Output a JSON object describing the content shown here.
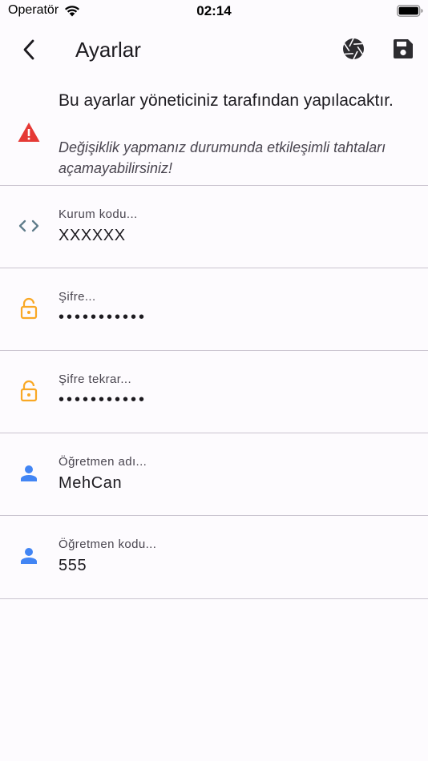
{
  "status_bar": {
    "carrier": "Operatör",
    "time": "02:14"
  },
  "app_bar": {
    "title": "Ayarlar"
  },
  "warning": {
    "title": "Bu ayarlar yöneticiniz tarafından yapılacaktır.",
    "subtitle": "Değişiklik yapmanız durumunda etkileşimli tahtaları açamayabilirsiniz!"
  },
  "fields": [
    {
      "label": "Kurum kodu...",
      "value": "XXXXXX",
      "icon": "code-icon"
    },
    {
      "label": "Şifre...",
      "value": "•••••••••••",
      "icon": "lock-open-icon"
    },
    {
      "label": "Şifre tekrar...",
      "value": "•••••••••••",
      "icon": "lock-open-icon"
    },
    {
      "label": "Öğretmen adı...",
      "value": "MehCan",
      "icon": "person-icon"
    },
    {
      "label": "Öğretmen kodu...",
      "value": "555",
      "icon": "person-icon"
    }
  ],
  "colors": {
    "background": "#fdfbfe",
    "warning_icon": "#e53935",
    "code_icon": "#5f7c8a",
    "lock_icon": "#f9a825",
    "person_icon": "#4285f4",
    "divider": "#cac4d0",
    "app_bar_icon": "#2d2c30"
  }
}
